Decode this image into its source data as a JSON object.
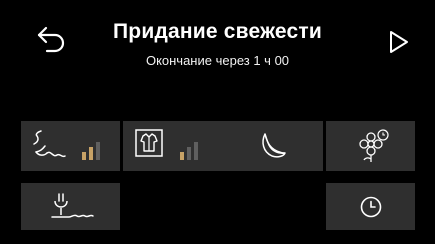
{
  "header": {
    "title": "Придание свежести",
    "subtitle": "Окончание через 1 ч 00"
  },
  "icons": {
    "back": "back-arrow-icon",
    "start": "play-icon",
    "steam_intensity": "steam-icon",
    "shirt": "shirt-icon",
    "feather": "feather-icon",
    "flower_timer": "flower-timer-icon",
    "water_drain": "water-tap-icon",
    "clock": "clock-icon"
  },
  "levels": {
    "steam_intensity": 2,
    "shirt_intensity": 1,
    "max": 3
  },
  "colors": {
    "background": "#000000",
    "tile": "#2f2f2f",
    "level_active": "#c7a266",
    "level_inactive": "#5f5f5f"
  }
}
